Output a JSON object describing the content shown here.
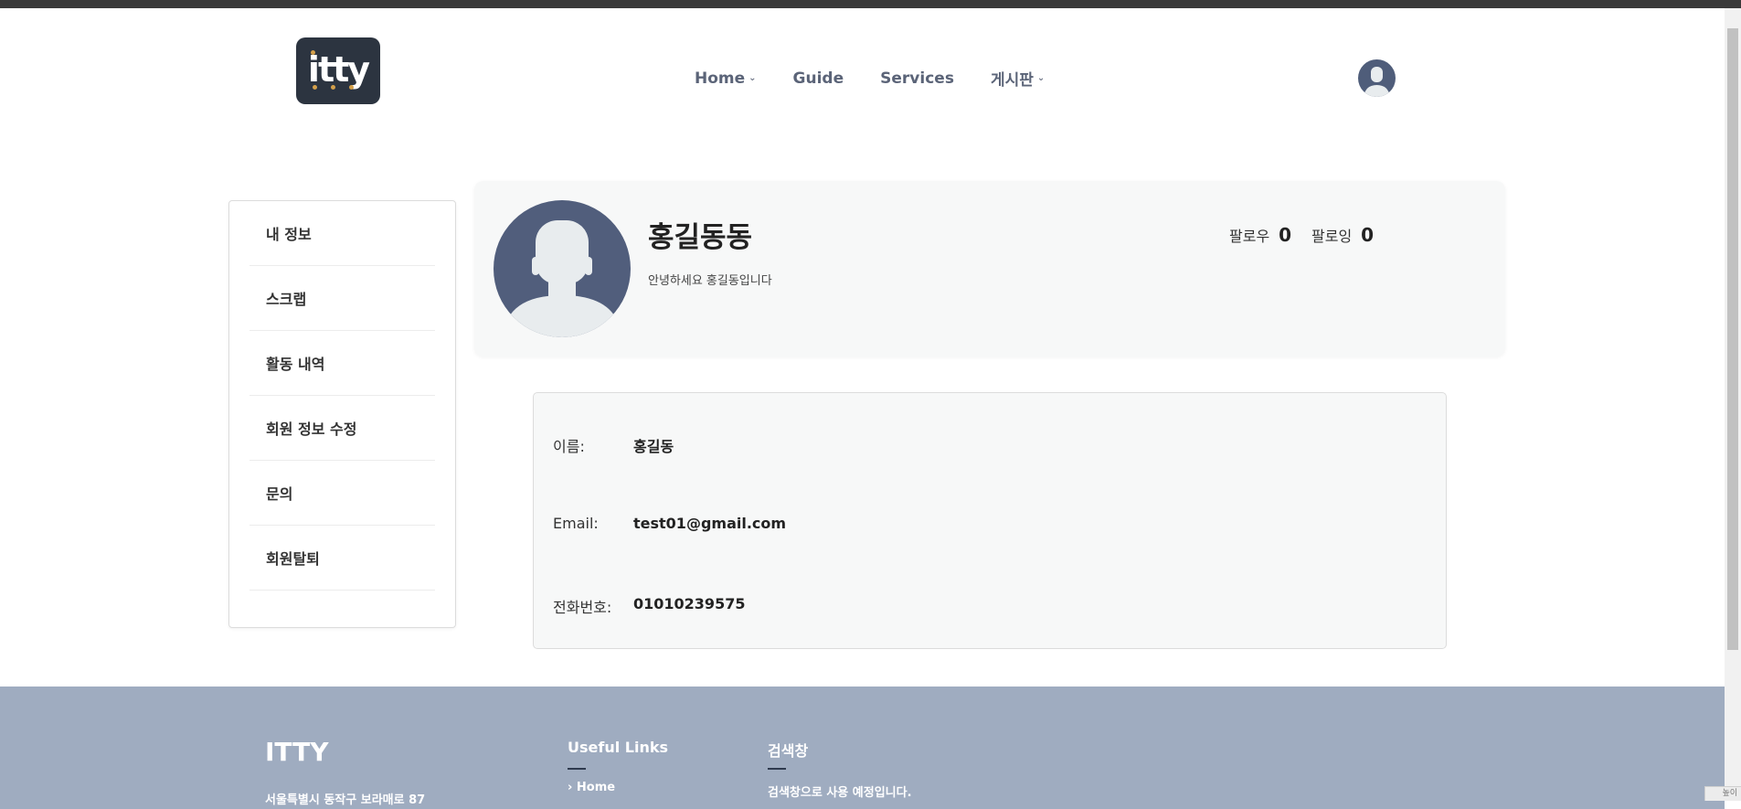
{
  "brand": {
    "logo_text": "itty",
    "logo_bg": "#2c3440",
    "logo_accent": "#d4a04a"
  },
  "nav": {
    "items": [
      {
        "label": "Home",
        "has_dropdown": true
      },
      {
        "label": "Guide",
        "has_dropdown": false
      },
      {
        "label": "Services",
        "has_dropdown": false
      },
      {
        "label": "게시판",
        "has_dropdown": true
      }
    ],
    "avatar_icon": "user-avatar-icon"
  },
  "sidebar": {
    "items": [
      {
        "label": "내 정보"
      },
      {
        "label": "스크랩"
      },
      {
        "label": "활동 내역"
      },
      {
        "label": "회원 정보 수정"
      },
      {
        "label": "문의"
      },
      {
        "label": "회원탈퇴"
      }
    ]
  },
  "profile": {
    "name": "홍길동동",
    "bio": "안녕하세요 홍길동입니다",
    "followers_label": "팔로우",
    "followers_count": "0",
    "following_label": "팔로잉",
    "following_count": "0",
    "avatar_icon": "user-avatar-icon"
  },
  "info": {
    "name_label": "이름:",
    "name_value": "홍길동",
    "email_label": "Email:",
    "email_value": "test01@gmail.com",
    "phone_label": "전화번호:",
    "phone_value": "01010239575"
  },
  "footer": {
    "brand": "ITTY",
    "address": "서울특별시 동작구 보라매로 87",
    "links_title": "Useful Links",
    "links": [
      {
        "label": "Home"
      }
    ],
    "search_title": "검색창",
    "search_text": "검색창으로 사용 예정입니다."
  },
  "colors": {
    "avatar_bg": "#515e7c",
    "footer_bg": "#9facc0",
    "card_bg": "#f7f8f8",
    "nav_text": "#5b6478"
  },
  "window": {
    "resize_label": "높이"
  }
}
